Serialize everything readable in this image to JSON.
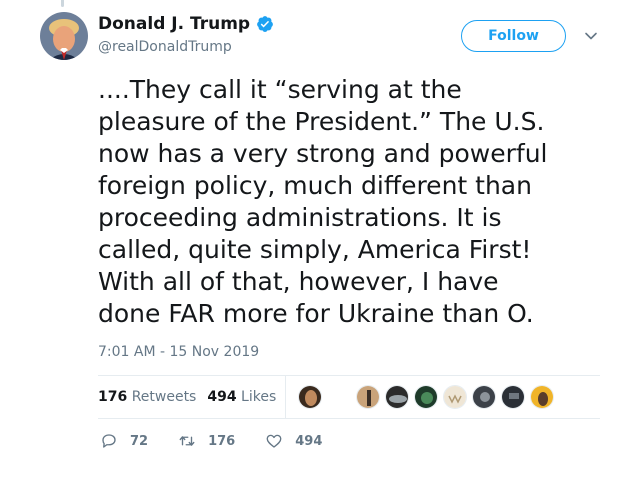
{
  "author": {
    "name": "Donald J. Trump",
    "handle": "@realDonaldTrump",
    "verified": true
  },
  "follow_label": "Follow",
  "tweet": {
    "text": "....They call it “serving at the\npleasure of the President.” The U.S.\nnow has a very strong and powerful\nforeign policy, much different than\nproceeding administrations. It is\ncalled, quite simply, America First!\nWith all of that, however, I have\ndone FAR more for Ukraine than O.",
    "timestamp": "7:01 AM - 15 Nov 2019"
  },
  "stats": {
    "retweets_count": "176",
    "retweets_label": "Retweets",
    "likes_count": "494",
    "likes_label": "Likes"
  },
  "actions": {
    "reply_count": "72",
    "retweet_count": "176",
    "like_count": "494"
  },
  "colors": {
    "accent": "#1da1f2",
    "text": "#14171a",
    "secondary": "#657786"
  },
  "icons": [
    "verified-badge-icon",
    "chevron-down-icon",
    "reply-icon",
    "retweet-icon",
    "heart-icon"
  ]
}
